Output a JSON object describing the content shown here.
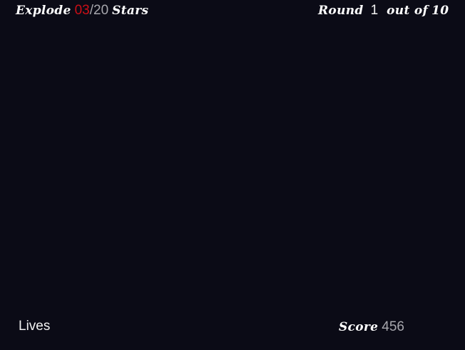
{
  "hud": {
    "goal": {
      "prefix": "Explode",
      "exploded": "03",
      "separator": "/",
      "target": "20",
      "suffix": "Stars"
    },
    "round": {
      "label": "Round",
      "current": "1",
      "middle": "out of",
      "total": "10"
    },
    "lives": {
      "label": "Lives"
    },
    "score": {
      "label": "Score",
      "value": "456"
    }
  },
  "colors": {
    "background": "#0b0b16",
    "highlight": "#cc0f16",
    "secondary": "#a7a7ad",
    "text": "#ffffff"
  }
}
